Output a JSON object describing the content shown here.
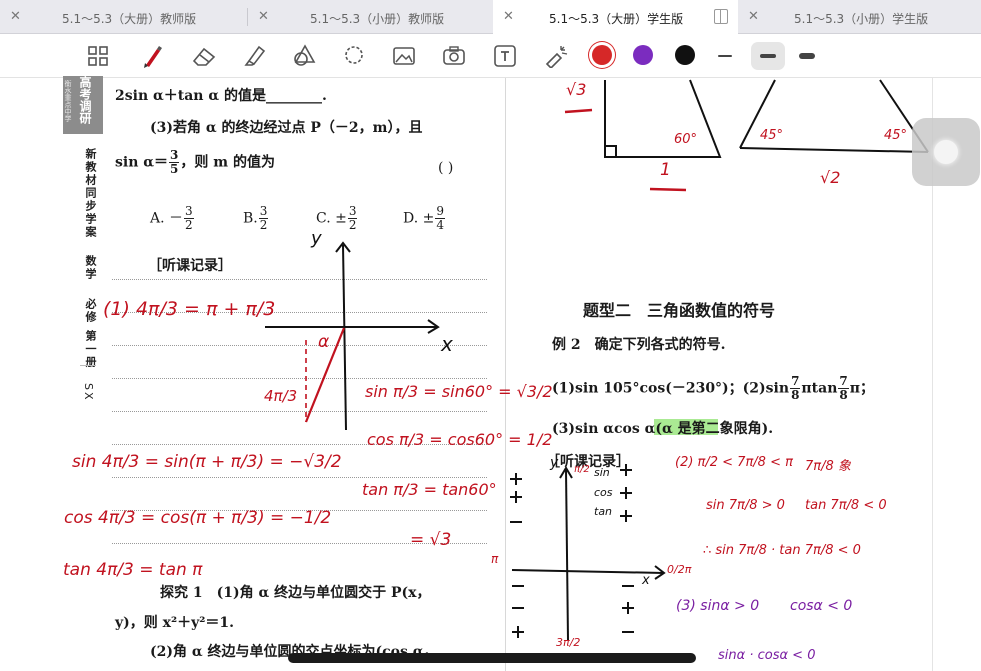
{
  "tabs": [
    {
      "label": "5.1～5.3（大册）教师版",
      "active": false
    },
    {
      "label": "5.1～5.3（小册）教师版",
      "active": false
    },
    {
      "label": "5.1～5.3（大册）学生版",
      "active": true
    },
    {
      "label": "5.1～5.3（小册）学生版",
      "active": false
    }
  ],
  "toolbar": {
    "tools": [
      "pen-icon",
      "eraser-icon",
      "highlighter-icon",
      "shapes-icon",
      "lasso-icon",
      "image-icon",
      "camera-icon",
      "text-icon",
      "laser-icon"
    ],
    "colors": [
      "#d62828",
      "#7b2cbf",
      "#111111"
    ],
    "selected_color": "#d62828"
  },
  "sidebar": {
    "logo_big": "高考调研",
    "logo_small": "衡水重点中学",
    "series": "新教材同步学案",
    "subject": "数学",
    "volume": "必修 第一册",
    "version": "SX"
  },
  "left_text": {
    "line1": "2sin α＋tan α 的值是________.",
    "q3": "(3)若角 α 的终边经过点 P（－2，m），且",
    "q3b_pre": "sin α＝",
    "q3b_num": "3",
    "q3b_den": "5",
    "q3b_post": "，则 m 的值为",
    "paren": "(        )",
    "opt_a": "A. －",
    "opt_b": "B.",
    "opt_c": "C. ±",
    "opt_d": "D. ±",
    "opt_a_num": "3",
    "opt_a_den": "2",
    "opt_b_num": "3",
    "opt_b_den": "2",
    "opt_c_num": "3",
    "opt_c_den": "2",
    "opt_d_num": "9",
    "opt_d_den": "4",
    "record": "［听课记录］",
    "explore1": "探究 1　(1)角 α 终边与单位圆交于 P(x，",
    "explore1b": "y)，则 x²＋y²＝1.",
    "explore2": "(2)角 α 终边与单位圆的交点坐标为(cos α，"
  },
  "right_text": {
    "topic": "题型二　三角函数值的符号",
    "example": "例 2　确定下列各式的符号.",
    "item1": "(1)sin 105°cos(－230°)；(2)sin",
    "item1_num": "7",
    "item1_den": "8",
    "item1_mid": "πtan",
    "item1_num2": "7",
    "item1_den2": "8",
    "item1_end": "π；",
    "item3": "(3)sin αcos α(α 是第二象限角).",
    "record": "［听课记录］"
  },
  "handwriting": {
    "red": {
      "line1": "(1) 4π/3 = π + π/3",
      "alpha": "α",
      "fourpi": "4π/3",
      "sinpi3": "sin π/3 = sin60° = √3/2",
      "cospi3": "cos π/3 = cos60° = 1/2",
      "tanpi3": "tan π/3 = tan60°",
      "eqrt3": "= √3",
      "sin4pi": "sin 4π/3 = sin(π + π/3) = −√3/2",
      "cos4pi": "cos 4π/3 = cos(π + π/3) = −1/2",
      "tan4pi": "tan 4π/3 = tan π",
      "sqrt3_top": "√3",
      "one": "1",
      "sqrt2": "√2",
      "deg60": "60°",
      "deg45a": "45°",
      "deg45b": "45°",
      "q2a": "(2) π/2 < 7π/8 < π",
      "q2b": "7π/8 象",
      "sin78": "sin 7π/8 > 0",
      "tan78": "tan 7π/8 < 0",
      "therefore": "∴ sin 7π/8 · tan 7π/8 < 0",
      "pi": "π",
      "zero2pi": "0/2π",
      "threepi2": "3π/2",
      "pi2": "π/2"
    },
    "purple": {
      "q3a": "(3) sinα > 0",
      "q3b": "cosα < 0",
      "q3c": "sinα · cosα < 0"
    },
    "ink": {
      "y1": "y",
      "x1": "x",
      "y2": "y",
      "x2": "x",
      "sin": "sin",
      "cos": "cos",
      "tan": "tan"
    }
  }
}
